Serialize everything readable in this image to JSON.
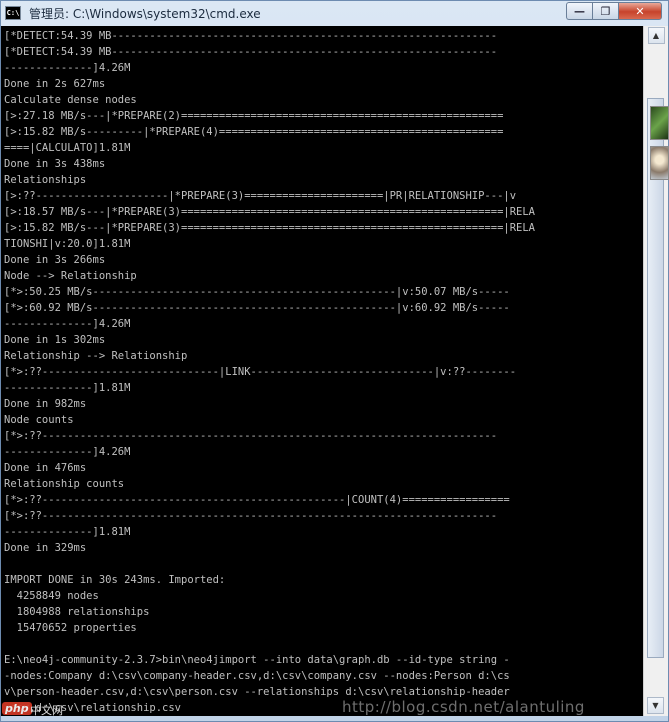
{
  "window": {
    "title": "管理员: C:\\Windows\\system32\\cmd.exe",
    "app_icon_text": "C:\\",
    "buttons": {
      "minimize": "—",
      "maximize": "❐",
      "close": "✕"
    }
  },
  "console": {
    "lines": [
      "[*DETECT:54.39 MB-------------------------------------------------------------",
      "[*DETECT:54.39 MB-------------------------------------------------------------",
      "--------------]4.26M",
      "Done in 2s 627ms",
      "Calculate dense nodes",
      "[>:27.18 MB/s---|*PREPARE(2)===================================================",
      "[>:15.82 MB/s---------|*PREPARE(4)=============================================",
      "====|CALCULATO]1.81M",
      "Done in 3s 438ms",
      "Relationships",
      "[>:??---------------------|*PREPARE(3)======================|PR|RELATIONSHIP---|v",
      "[>:18.57 MB/s---|*PREPARE(3)===================================================|RELA",
      "[>:15.82 MB/s---|*PREPARE(3)===================================================|RELA",
      "TIONSHI|v:20.0]1.81M",
      "Done in 3s 266ms",
      "Node --> Relationship",
      "[*>:50.25 MB/s------------------------------------------------|v:50.07 MB/s-----",
      "[*>:60.92 MB/s------------------------------------------------|v:60.92 MB/s-----",
      "--------------]4.26M",
      "Done in 1s 302ms",
      "Relationship --> Relationship",
      "[*>:??----------------------------|LINK-----------------------------|v:??--------",
      "--------------]1.81M",
      "Done in 982ms",
      "Node counts",
      "[*>:??------------------------------------------------------------------------",
      "--------------]4.26M",
      "Done in 476ms",
      "Relationship counts",
      "[*>:??------------------------------------------------|COUNT(4)=================",
      "[*>:??------------------------------------------------------------------------",
      "--------------]1.81M",
      "Done in 329ms",
      "",
      "IMPORT DONE in 30s 243ms. Imported:",
      "  4258849 nodes",
      "  1804988 relationships",
      "  15470652 properties",
      "",
      "E:\\neo4j-community-2.3.7>bin\\neo4jimport --into data\\graph.db --id-type string -",
      "-nodes:Company d:\\csv\\company-header.csv,d:\\csv\\company.csv --nodes:Person d:\\cs",
      "v\\person-header.csv,d:\\csv\\person.csv --relationships d:\\csv\\relationship-header",
      ".csv,d:\\csv\\relationship.csv"
    ]
  },
  "watermark": {
    "logo": "php",
    "site_cn": "中文网",
    "url": "http://blog.csdn.net/alantuling"
  },
  "colors": {
    "console_bg": "#000000",
    "console_fg": "#c0c0c0",
    "close_button": "#c7432b"
  }
}
